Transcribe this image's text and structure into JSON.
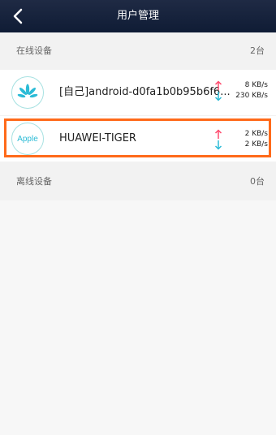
{
  "header": {
    "title": "用户管理"
  },
  "online": {
    "label": "在线设备",
    "count": "2台",
    "devices": [
      {
        "name": "[自己]android-d0fa1b0b95b6f6...",
        "up": "8 KB/s",
        "down": "230 KB/s",
        "logo_icon": "huawei-logo-icon"
      },
      {
        "name": "HUAWEI-TIGER",
        "up": "2 KB/s",
        "down": "2 KB/s",
        "logo_text": "Apple",
        "highlighted": true
      }
    ]
  },
  "offline": {
    "label": "离线设备",
    "count": "0台"
  },
  "colors": {
    "header_bg": "#1f2a44",
    "up_arrow": "#ff4b6e",
    "down_arrow": "#2bbbd6",
    "highlight_border": "#ff6a1a",
    "logo_ring": "#a6e1e1"
  }
}
